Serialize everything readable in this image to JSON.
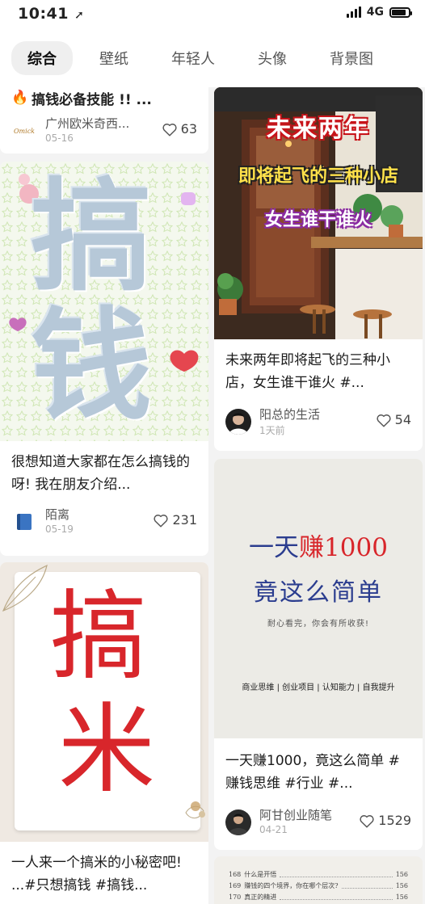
{
  "status": {
    "time": "10:41",
    "network": "4G",
    "battery_level": 0.85
  },
  "tabs": [
    {
      "label": "综合",
      "active": true
    },
    {
      "label": "壁纸",
      "active": false
    },
    {
      "label": "年轻人",
      "active": false
    },
    {
      "label": "头像",
      "active": false
    },
    {
      "label": "背景图",
      "active": false
    }
  ],
  "cards": {
    "top_left": {
      "title_fragment": "搞钱必备技能 !! ...",
      "author": "广州欧米奇西...",
      "avatar_text": "Omick",
      "date": "05-16",
      "likes": "63"
    },
    "money": {
      "cover_text": "搞钱",
      "title": "很想知道大家都在怎么搞钱的呀! 我在朋友介绍...",
      "author": "陌离",
      "date": "05-19",
      "likes": "231"
    },
    "rice": {
      "cover_text_1": "搞",
      "cover_text_2": "米",
      "title": "一人来一个搞米的小秘密吧! ...#只想搞钱 #搞钱..."
    },
    "shop": {
      "cover_line_1": "未来两年",
      "cover_line_2": "即将起飞的三种小店",
      "cover_line_3": "女生谁干谁火",
      "title": "未来两年即将起飞的三种小店，女生谁干谁火 #...",
      "author": "阳总的生活",
      "date": "1天前",
      "likes": "54"
    },
    "earn": {
      "cover_line_1a": "一天",
      "cover_line_1b": "赚",
      "cover_line_1c": "1000",
      "cover_line_2": "竟这么简单",
      "cover_line_3": "耐心看完，你会有所收获!",
      "cover_line_4": "商业思维 | 创业项目 | 认知能力 | 自我提升",
      "title": "一天赚1000，竟这么简单 #赚钱思维 #行业 #...",
      "author": "阿甘创业随笔",
      "date": "04-21",
      "likes": "1529"
    },
    "list": {
      "rows": [
        {
          "num": "168",
          "text": "什么是开悟",
          "page": "156"
        },
        {
          "num": "169",
          "text": "赚钱的四个境界，你在哪个层次?",
          "page": "156"
        },
        {
          "num": "170",
          "text": "真正的精进",
          "page": "156"
        }
      ]
    }
  },
  "colors": {
    "accent_red": "#d8262b",
    "text_dark": "#1b1b1b",
    "text_gray": "#555555"
  }
}
